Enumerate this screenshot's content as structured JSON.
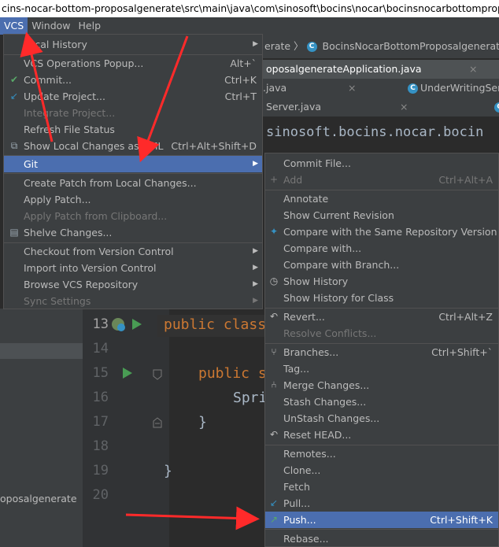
{
  "title": "cins-nocar-bottom-proposalgenerate\\src\\main\\java\\com\\sinosoft\\bocins\\nocar\\bocinsnocarbottomproposal",
  "menubar": {
    "vcs": "VCS",
    "window": "Window",
    "help": "Help"
  },
  "editor": {
    "breadcrumb": "erate 〉",
    "breadcrumb_class": "BocinsNocarBottomProposalgenerateApplication",
    "tab1": "oposalgenerateApplication.java",
    "tab2": ".java",
    "tab3": "UnderWritingSer",
    "tab4": "Server.java",
    "close": "×",
    "package_line": "sinosoft.bocins.nocar.bocin",
    "line_numbers": [
      "13",
      "14",
      "15",
      "16",
      "17",
      "18",
      "19",
      "20"
    ],
    "code": {
      "l13a": "public",
      "l13b": "class",
      "l15a": "public",
      "l15b": "s",
      "l16": "Spri",
      "l17": "}",
      "l19": "}"
    },
    "project_item": "oposalgenerate"
  },
  "vcs_menu": {
    "local_history": "Local History",
    "vcs_operations_popup": "VCS Operations Popup...",
    "vcs_operations_popup_sc": "Alt+`",
    "commit": "Commit...",
    "commit_sc": "Ctrl+K",
    "update_project": "Update Project...",
    "update_project_sc": "Ctrl+T",
    "integrate_project": "Integrate Project...",
    "refresh_file_status": "Refresh File Status",
    "show_local_changes_uml": "Show Local Changes as UML",
    "show_local_changes_uml_sc": "Ctrl+Alt+Shift+D",
    "git": "Git",
    "create_patch": "Create Patch from Local Changes...",
    "apply_patch": "Apply Patch...",
    "apply_patch_clipboard": "Apply Patch from Clipboard...",
    "shelve_changes": "Shelve Changes...",
    "checkout_vc": "Checkout from Version Control",
    "import_vc": "Import into Version Control",
    "browse_vcs_repo": "Browse VCS Repository",
    "sync_settings": "Sync Settings"
  },
  "git_menu": {
    "commit_file": "Commit File...",
    "add": "Add",
    "add_sc": "Ctrl+Alt+A",
    "annotate": "Annotate",
    "show_current_revision": "Show Current Revision",
    "compare_same_repo": "Compare with the Same Repository Version",
    "compare_with": "Compare with...",
    "compare_with_branch": "Compare with Branch...",
    "show_history": "Show History",
    "show_history_class": "Show History for Class",
    "revert": "Revert...",
    "revert_sc": "Ctrl+Alt+Z",
    "resolve_conflicts": "Resolve Conflicts...",
    "branches": "Branches...",
    "branches_sc": "Ctrl+Shift+`",
    "tag": "Tag...",
    "merge_changes": "Merge Changes...",
    "stash_changes": "Stash Changes...",
    "unstash_changes": "UnStash Changes...",
    "reset_head": "Reset HEAD...",
    "remotes": "Remotes...",
    "clone": "Clone...",
    "fetch": "Fetch",
    "pull": "Pull...",
    "push": "Push...",
    "push_sc": "Ctrl+Shift+K",
    "rebase": "Rebase..."
  },
  "colors": {
    "accent": "#4b6eaf",
    "arrow": "#ff2a2a",
    "menu_bg": "#3c3f41",
    "keyword": "#cc7832"
  }
}
